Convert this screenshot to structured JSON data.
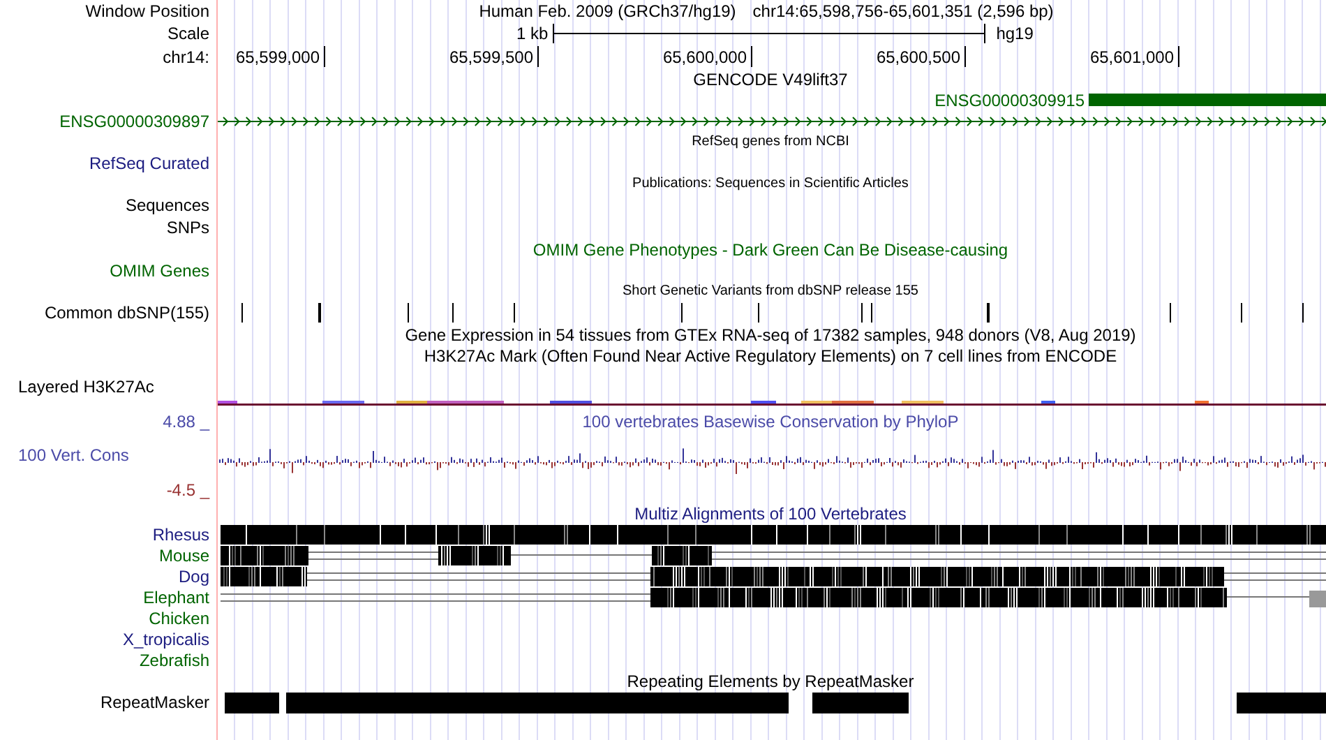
{
  "header": {
    "label": "Window Position",
    "assembly": "Human Feb. 2009 (GRCh37/hg19)",
    "position": "chr14:65,598,756-65,601,351 (2,596 bp)"
  },
  "scale": {
    "label": "Scale",
    "length": "1 kb",
    "assembly": "hg19"
  },
  "ruler": {
    "label": "chr14:",
    "ticks": [
      "65,599,000",
      "65,599,500",
      "65,600,000",
      "65,600,500",
      "65,601,000"
    ]
  },
  "rows": [
    {
      "kind": "heading",
      "title": {
        "text": "GENCODE V49lift37",
        "color": "#000000"
      }
    },
    {
      "kind": "gene_block",
      "feature": {
        "text": "ENSG00000309915",
        "color": "#006400"
      }
    },
    {
      "kind": "gene_arrows",
      "label": {
        "text": "ENSG00000309897",
        "color": "#006400"
      }
    },
    {
      "kind": "caption",
      "title": {
        "text": "RefSeq genes from NCBI",
        "color": "#000000"
      }
    },
    {
      "kind": "blank",
      "label": {
        "text": "RefSeq Curated",
        "color": "#1c1c80"
      }
    },
    {
      "kind": "caption",
      "title": {
        "text": "Publications: Sequences in Scientific Articles",
        "color": "#000000"
      }
    },
    {
      "kind": "blank",
      "label": {
        "text": "Sequences",
        "color": "#000000"
      }
    },
    {
      "kind": "blank",
      "label": {
        "text": "SNPs",
        "color": "#000000"
      }
    },
    {
      "kind": "heading",
      "title": {
        "text": "OMIM Gene Phenotypes - Dark Green Can Be Disease-causing",
        "color": "#006400"
      }
    },
    {
      "kind": "blank",
      "label": {
        "text": "OMIM Genes",
        "color": "#006400"
      }
    },
    {
      "kind": "caption",
      "title": {
        "text": "Short Genetic Variants from dbSNP release 155",
        "color": "#000000"
      }
    },
    {
      "kind": "snp_ticks",
      "label": {
        "text": "Common dbSNP(155)",
        "color": "#000000"
      }
    },
    {
      "kind": "heading",
      "title": {
        "text": "Gene Expression in 54 tissues from GTEx RNA-seq of 17382 samples, 948 donors (V8, Aug 2019)",
        "color": "#000000"
      }
    },
    {
      "kind": "heading",
      "title": {
        "text": "H3K27Ac Mark (Often Found Near Active Regulatory Elements) on 7 cell lines from ENCODE",
        "color": "#000000"
      }
    },
    {
      "kind": "layered",
      "label": {
        "text": "Layered H3K27Ac",
        "color": "#000000"
      }
    },
    {
      "kind": "scale_mark",
      "label": {
        "text": "4.88 _",
        "color": "#4b4ba8"
      },
      "title": {
        "text": "100 vertebrates Basewise Conservation by PhyloP",
        "color": "#4b4ba8"
      }
    },
    {
      "kind": "wiggle",
      "label": {
        "text": "100 Vert. Cons",
        "color": "#4b4ba8"
      }
    },
    {
      "kind": "scale_mark",
      "label": {
        "text": "-4.5 _",
        "color": "#993333"
      }
    },
    {
      "kind": "heading",
      "title": {
        "text": "Multiz Alignments of 100 Vertebrates",
        "color": "#1c1c80"
      }
    },
    {
      "kind": "alignment",
      "label": {
        "text": "Rhesus",
        "color": "#1c1c80"
      }
    },
    {
      "kind": "alignment",
      "label": {
        "text": "Mouse",
        "color": "#006400"
      }
    },
    {
      "kind": "alignment",
      "label": {
        "text": "Dog",
        "color": "#1c1c80"
      }
    },
    {
      "kind": "alignment",
      "label": {
        "text": "Elephant",
        "color": "#006400"
      }
    },
    {
      "kind": "alignment",
      "label": {
        "text": "Chicken",
        "color": "#006400"
      }
    },
    {
      "kind": "alignment",
      "label": {
        "text": "X_tropicalis",
        "color": "#1c1c80"
      }
    },
    {
      "kind": "alignment",
      "label": {
        "text": "Zebrafish",
        "color": "#006400"
      }
    },
    {
      "kind": "heading",
      "title": {
        "text": "Repeating Elements by RepeatMasker",
        "color": "#000000"
      }
    },
    {
      "kind": "repeats",
      "label": {
        "text": "RepeatMasker",
        "color": "#000000"
      }
    }
  ]
}
